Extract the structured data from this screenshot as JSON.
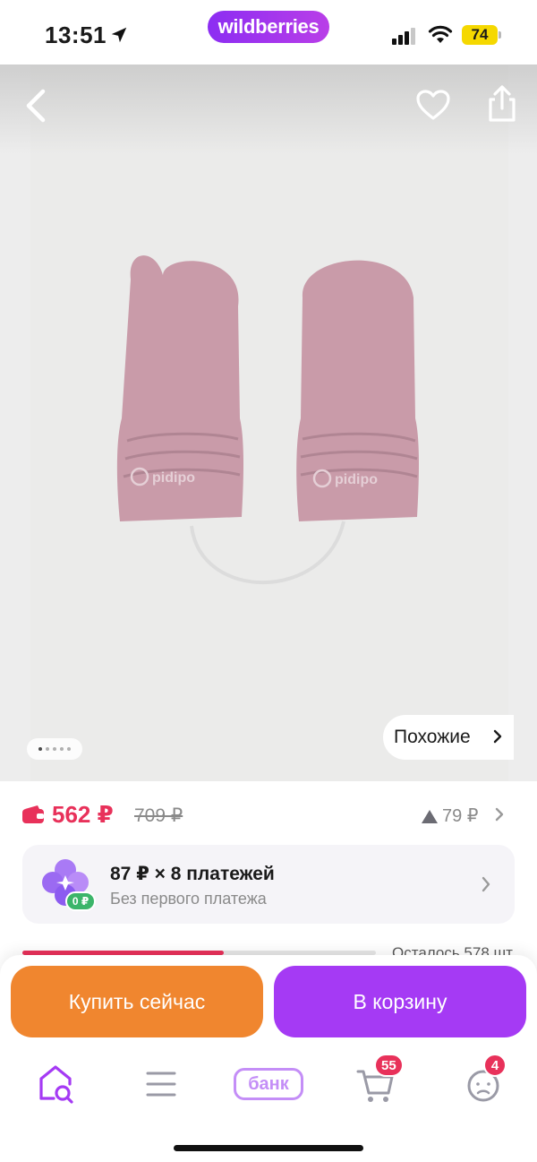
{
  "status_bar": {
    "time": "13:51",
    "brand": "wildberries",
    "battery": "74"
  },
  "gallery": {
    "similar_label": "Похожие",
    "dots_count": 5,
    "active_dot": 0,
    "product_logo_text": "pidipo"
  },
  "price": {
    "current": "562 ₽",
    "old": "709 ₽",
    "increase": "79 ₽",
    "current_color": "#e8315a"
  },
  "installments": {
    "title": "87 ₽ × 8 платежей",
    "subtitle": "Без первого платежа",
    "badge": "0 ₽"
  },
  "stock": {
    "text": "Осталось 578 шт",
    "level": 0.57
  },
  "actions": {
    "buy_now": "Купить сейчас",
    "add_to_cart": "В корзину"
  },
  "tabbar": {
    "bank_label": "банк",
    "cart_badge": "55",
    "profile_badge": "4",
    "accent_color": "#a53af4"
  }
}
